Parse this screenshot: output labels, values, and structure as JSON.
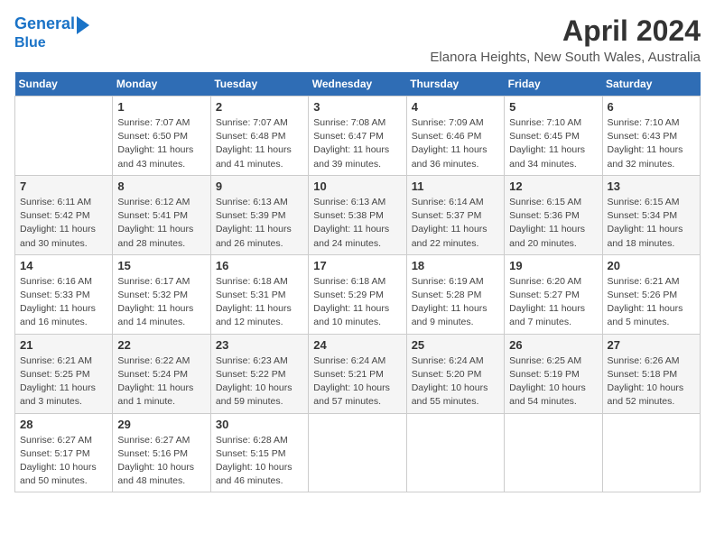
{
  "header": {
    "logo_line1": "General",
    "logo_line2": "Blue",
    "month": "April 2024",
    "location": "Elanora Heights, New South Wales, Australia"
  },
  "weekdays": [
    "Sunday",
    "Monday",
    "Tuesday",
    "Wednesday",
    "Thursday",
    "Friday",
    "Saturday"
  ],
  "weeks": [
    [
      {
        "day": "",
        "info": ""
      },
      {
        "day": "1",
        "info": "Sunrise: 7:07 AM\nSunset: 6:50 PM\nDaylight: 11 hours\nand 43 minutes."
      },
      {
        "day": "2",
        "info": "Sunrise: 7:07 AM\nSunset: 6:48 PM\nDaylight: 11 hours\nand 41 minutes."
      },
      {
        "day": "3",
        "info": "Sunrise: 7:08 AM\nSunset: 6:47 PM\nDaylight: 11 hours\nand 39 minutes."
      },
      {
        "day": "4",
        "info": "Sunrise: 7:09 AM\nSunset: 6:46 PM\nDaylight: 11 hours\nand 36 minutes."
      },
      {
        "day": "5",
        "info": "Sunrise: 7:10 AM\nSunset: 6:45 PM\nDaylight: 11 hours\nand 34 minutes."
      },
      {
        "day": "6",
        "info": "Sunrise: 7:10 AM\nSunset: 6:43 PM\nDaylight: 11 hours\nand 32 minutes."
      }
    ],
    [
      {
        "day": "7",
        "info": "Sunrise: 6:11 AM\nSunset: 5:42 PM\nDaylight: 11 hours\nand 30 minutes."
      },
      {
        "day": "8",
        "info": "Sunrise: 6:12 AM\nSunset: 5:41 PM\nDaylight: 11 hours\nand 28 minutes."
      },
      {
        "day": "9",
        "info": "Sunrise: 6:13 AM\nSunset: 5:39 PM\nDaylight: 11 hours\nand 26 minutes."
      },
      {
        "day": "10",
        "info": "Sunrise: 6:13 AM\nSunset: 5:38 PM\nDaylight: 11 hours\nand 24 minutes."
      },
      {
        "day": "11",
        "info": "Sunrise: 6:14 AM\nSunset: 5:37 PM\nDaylight: 11 hours\nand 22 minutes."
      },
      {
        "day": "12",
        "info": "Sunrise: 6:15 AM\nSunset: 5:36 PM\nDaylight: 11 hours\nand 20 minutes."
      },
      {
        "day": "13",
        "info": "Sunrise: 6:15 AM\nSunset: 5:34 PM\nDaylight: 11 hours\nand 18 minutes."
      }
    ],
    [
      {
        "day": "14",
        "info": "Sunrise: 6:16 AM\nSunset: 5:33 PM\nDaylight: 11 hours\nand 16 minutes."
      },
      {
        "day": "15",
        "info": "Sunrise: 6:17 AM\nSunset: 5:32 PM\nDaylight: 11 hours\nand 14 minutes."
      },
      {
        "day": "16",
        "info": "Sunrise: 6:18 AM\nSunset: 5:31 PM\nDaylight: 11 hours\nand 12 minutes."
      },
      {
        "day": "17",
        "info": "Sunrise: 6:18 AM\nSunset: 5:29 PM\nDaylight: 11 hours\nand 10 minutes."
      },
      {
        "day": "18",
        "info": "Sunrise: 6:19 AM\nSunset: 5:28 PM\nDaylight: 11 hours\nand 9 minutes."
      },
      {
        "day": "19",
        "info": "Sunrise: 6:20 AM\nSunset: 5:27 PM\nDaylight: 11 hours\nand 7 minutes."
      },
      {
        "day": "20",
        "info": "Sunrise: 6:21 AM\nSunset: 5:26 PM\nDaylight: 11 hours\nand 5 minutes."
      }
    ],
    [
      {
        "day": "21",
        "info": "Sunrise: 6:21 AM\nSunset: 5:25 PM\nDaylight: 11 hours\nand 3 minutes."
      },
      {
        "day": "22",
        "info": "Sunrise: 6:22 AM\nSunset: 5:24 PM\nDaylight: 11 hours\nand 1 minute."
      },
      {
        "day": "23",
        "info": "Sunrise: 6:23 AM\nSunset: 5:22 PM\nDaylight: 10 hours\nand 59 minutes."
      },
      {
        "day": "24",
        "info": "Sunrise: 6:24 AM\nSunset: 5:21 PM\nDaylight: 10 hours\nand 57 minutes."
      },
      {
        "day": "25",
        "info": "Sunrise: 6:24 AM\nSunset: 5:20 PM\nDaylight: 10 hours\nand 55 minutes."
      },
      {
        "day": "26",
        "info": "Sunrise: 6:25 AM\nSunset: 5:19 PM\nDaylight: 10 hours\nand 54 minutes."
      },
      {
        "day": "27",
        "info": "Sunrise: 6:26 AM\nSunset: 5:18 PM\nDaylight: 10 hours\nand 52 minutes."
      }
    ],
    [
      {
        "day": "28",
        "info": "Sunrise: 6:27 AM\nSunset: 5:17 PM\nDaylight: 10 hours\nand 50 minutes."
      },
      {
        "day": "29",
        "info": "Sunrise: 6:27 AM\nSunset: 5:16 PM\nDaylight: 10 hours\nand 48 minutes."
      },
      {
        "day": "30",
        "info": "Sunrise: 6:28 AM\nSunset: 5:15 PM\nDaylight: 10 hours\nand 46 minutes."
      },
      {
        "day": "",
        "info": ""
      },
      {
        "day": "",
        "info": ""
      },
      {
        "day": "",
        "info": ""
      },
      {
        "day": "",
        "info": ""
      }
    ]
  ]
}
